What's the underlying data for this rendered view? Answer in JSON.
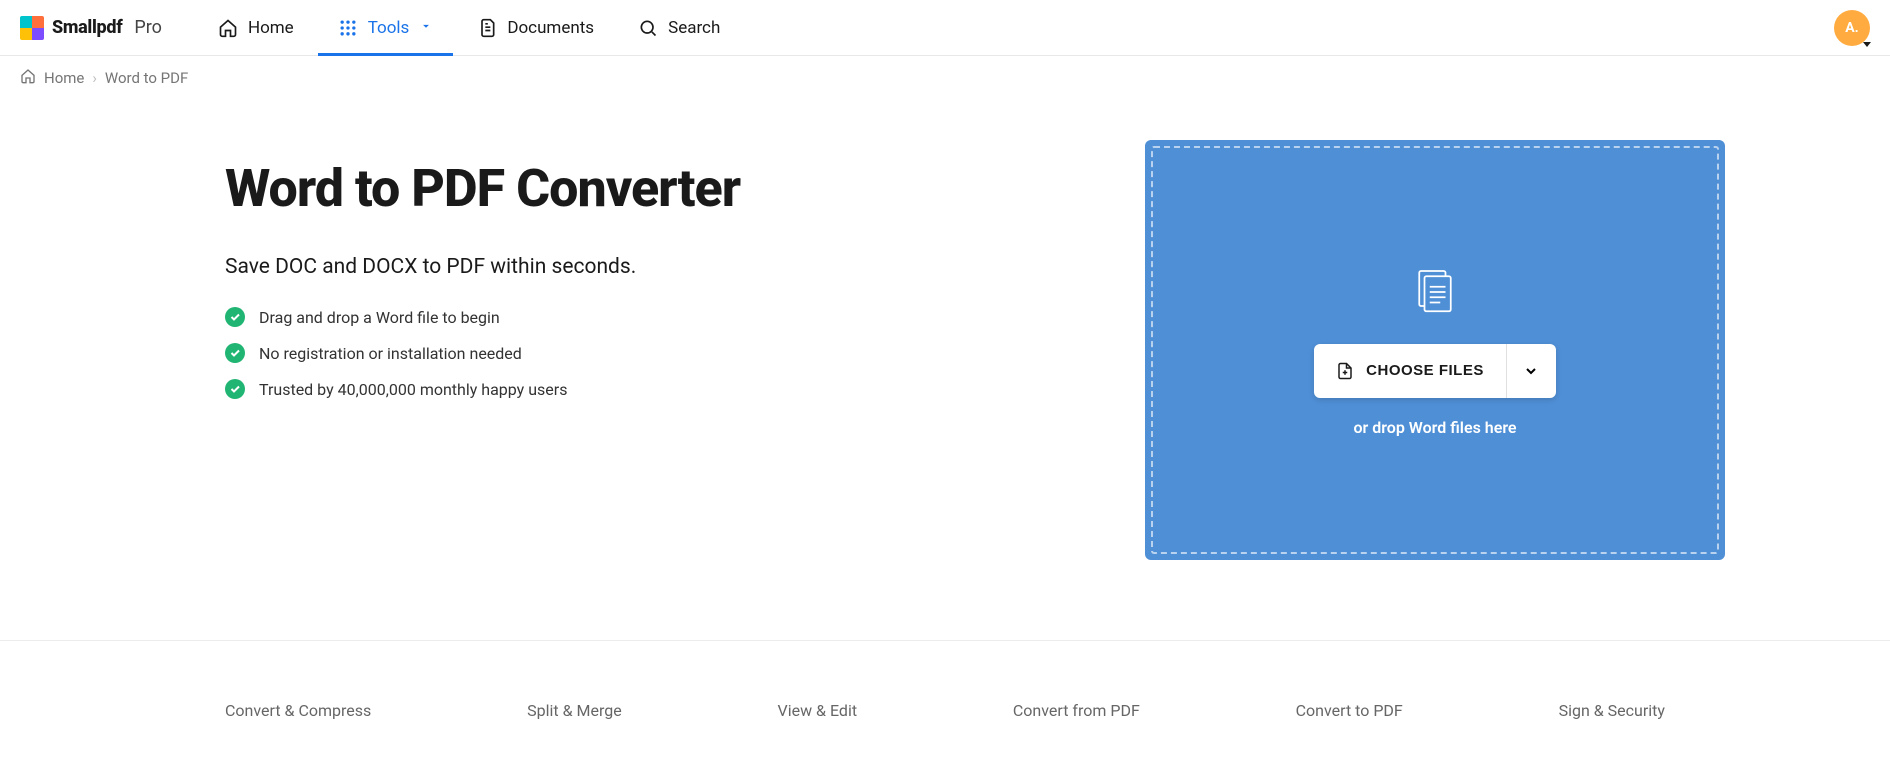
{
  "brand": {
    "name": "Smallpdf",
    "tier": "Pro"
  },
  "nav": {
    "home": "Home",
    "tools": "Tools",
    "documents": "Documents",
    "search": "Search"
  },
  "avatar": {
    "initial": "A."
  },
  "breadcrumb": {
    "home": "Home",
    "current": "Word to PDF"
  },
  "hero": {
    "title": "Word to PDF Converter",
    "subtitle": "Save DOC and DOCX to PDF within seconds.",
    "features": [
      "Drag and drop a Word file to begin",
      "No registration or installation needed",
      "Trusted by 40,000,000 monthly happy users"
    ],
    "choose_label": "CHOOSE FILES",
    "drop_hint": "or drop Word files here"
  },
  "categories": [
    "Convert & Compress",
    "Split & Merge",
    "View & Edit",
    "Convert from PDF",
    "Convert to PDF",
    "Sign & Security"
  ]
}
